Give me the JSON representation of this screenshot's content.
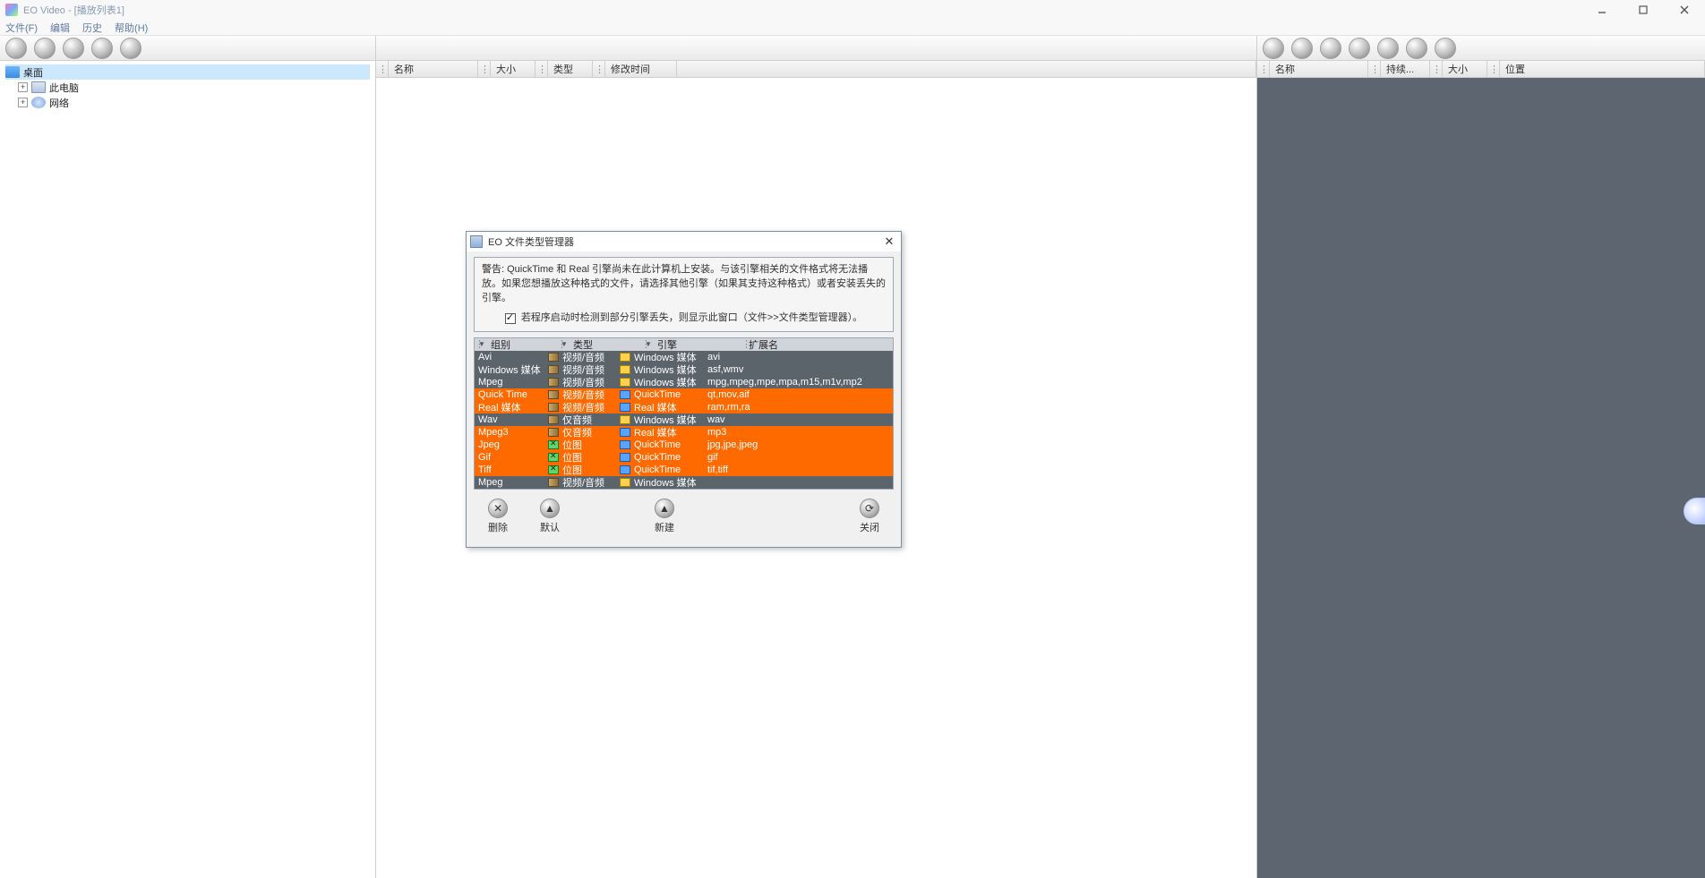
{
  "window": {
    "title": "EO Video - [播放列表1]",
    "menus": [
      "文件(F)",
      "编辑",
      "历史",
      "帮助(H)"
    ]
  },
  "tree": {
    "root": "桌面",
    "items": [
      {
        "label": "此电脑"
      },
      {
        "label": "网络"
      }
    ]
  },
  "mid_cols": {
    "name": "名称",
    "size": "大小",
    "type": "类型",
    "modified": "修改时间"
  },
  "right_cols": {
    "name": "名称",
    "cont": "持续...",
    "size": "大小",
    "loc": "位置"
  },
  "dialog": {
    "title": "EO 文件类型管理器",
    "warn_lead": "警告:",
    "warn_text": "QuickTime 和 Real 引擎尚未在此计算机上安装。与该引擎相关的文件格式将无法播放。如果您想播放这种格式的文件，请选择其他引擎（如果其支持这种格式）或者安装丢失的引擎。",
    "checkbox_label": "若程序启动时检测到部分引擎丢失，则显示此窗口（文件>>文件类型管理器）。",
    "headers": {
      "cat": "组别",
      "type": "类型",
      "eng": "引擎",
      "ext": "扩展名"
    },
    "rows": [
      {
        "cat": "Avi",
        "type": "视频/音频",
        "eng": "Windows 媒体",
        "ext": "avi",
        "hl": false,
        "eico": "y"
      },
      {
        "cat": "Windows 媒体",
        "type": "视频/音频",
        "eng": "Windows 媒体",
        "ext": "asf,wmv",
        "hl": false,
        "eico": "y"
      },
      {
        "cat": "Mpeg",
        "type": "视频/音频",
        "eng": "Windows 媒体",
        "ext": "mpg,mpeg,mpe,mpa,m15,m1v,mp2",
        "hl": false,
        "eico": "y"
      },
      {
        "cat": "Quick Time",
        "type": "视频/音频",
        "eng": "QuickTime",
        "ext": "qt,mov,aif",
        "hl": true,
        "eico": "b"
      },
      {
        "cat": "Real 媒体",
        "type": "视频/音频",
        "eng": "Real 媒体",
        "ext": "ram,rm,ra",
        "hl": true,
        "eico": "b"
      },
      {
        "cat": "Wav",
        "type": "仅音频",
        "eng": "Windows 媒体",
        "ext": "wav",
        "hl": false,
        "eico": "y"
      },
      {
        "cat": "Mpeg3",
        "type": "仅音频",
        "eng": "Real 媒体",
        "ext": "mp3",
        "hl": true,
        "eico": "b"
      },
      {
        "cat": "Jpeg",
        "type": "位图",
        "eng": "QuickTime",
        "ext": "jpg,jpe,jpeg",
        "hl": true,
        "eico": "b",
        "tico": "x"
      },
      {
        "cat": "Gif",
        "type": "位图",
        "eng": "QuickTime",
        "ext": "gif",
        "hl": true,
        "eico": "b",
        "tico": "x"
      },
      {
        "cat": "Tiff",
        "type": "位图",
        "eng": "QuickTime",
        "ext": "tif,tiff",
        "hl": true,
        "eico": "b",
        "tico": "x"
      },
      {
        "cat": "Mpeg",
        "type": "视频/音频",
        "eng": "Windows 媒体",
        "ext": "",
        "hl": false,
        "eico": "y"
      }
    ],
    "buttons": {
      "delete": "删除",
      "default": "默认",
      "new": "新建",
      "close": "关闭"
    }
  }
}
